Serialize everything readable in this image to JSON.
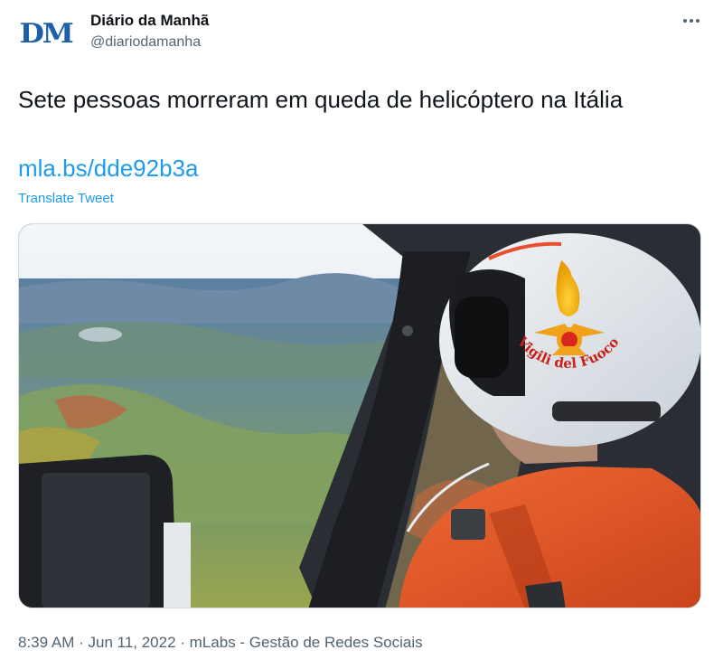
{
  "author": {
    "avatar_text": "DM",
    "display_name": "Diário da Manhã",
    "handle": "@diariodamanha"
  },
  "tweet": {
    "text": "Sete pessoas morreram em queda de helicóptero na Itália",
    "link": "mla.bs/dde92b3a",
    "translate_label": "Translate Tweet",
    "time": "8:39 AM",
    "date": "Jun 11, 2022",
    "source": "mLabs - Gestão de Redes Sociais"
  },
  "media": {
    "helmet_text": "Vigili del Fuoco"
  },
  "colors": {
    "link": "#1d9bf0",
    "secondary_text": "#536471",
    "logo": "#1d5fa8",
    "suit": "#e8572a"
  },
  "icons": {
    "more": "more-dots-icon"
  }
}
